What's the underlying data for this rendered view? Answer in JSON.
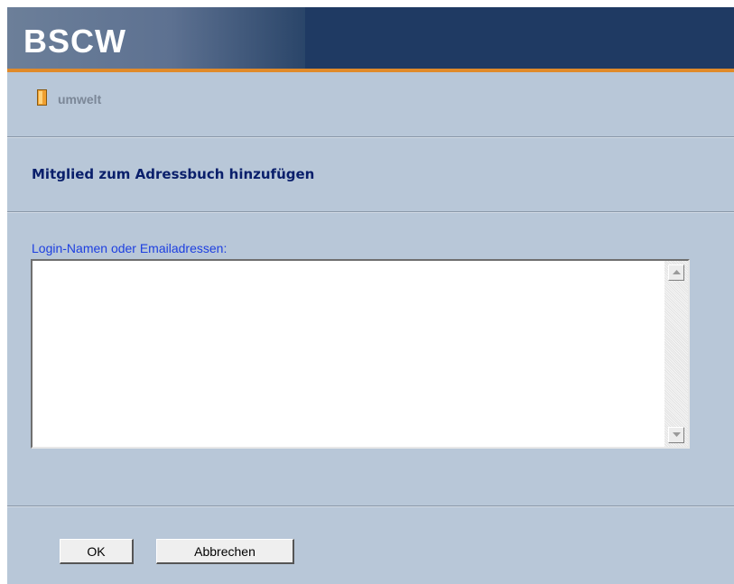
{
  "header": {
    "logo_text": "BSCW",
    "bar_color": "#1f3a63",
    "accent_color": "#e08a2a"
  },
  "breadcrumb": {
    "icon": "folder-icon",
    "label": "umwelt"
  },
  "page_title": "Mitglied zum Adressbuch hinzufügen",
  "form": {
    "field_label": "Login-Namen oder Emailadressen:",
    "field_value": "",
    "ok_label": "OK",
    "cancel_label": "Abbrechen"
  },
  "colors": {
    "background": "#b8c7d8",
    "title": "#0a1f6b",
    "label": "#1d3fe0"
  }
}
